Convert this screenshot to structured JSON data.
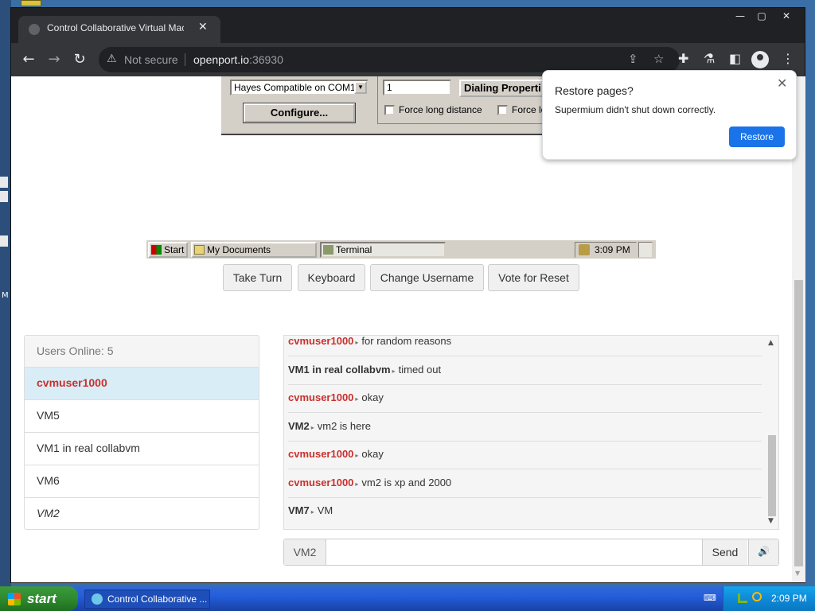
{
  "browser": {
    "tab_title": "Control Collaborative Virtual Machine",
    "url_security": "Not secure",
    "url_host": "openport.io",
    "url_port": ":36930"
  },
  "vm_screen": {
    "modem_select_value": "Hayes Compatible on COM1",
    "configure_label": "Configure...",
    "area_code_value": "1",
    "dialing_properties_label": "Dialing Properti",
    "force_long_distance_label": "Force long distance",
    "force_local_label": "Force lo",
    "taskbar": {
      "start_label": "Start",
      "my_documents_label": "My Documents",
      "terminal_label": "Terminal",
      "clock": "3:09 PM"
    }
  },
  "controls": {
    "take_turn": "Take Turn",
    "keyboard": "Keyboard",
    "change_username": "Change Username",
    "vote_reset": "Vote for Reset"
  },
  "users": {
    "heading": "Users Online: 5",
    "list": [
      "cvmuser1000",
      "VM5",
      "VM1 in real collabvm",
      "VM6",
      "VM2"
    ]
  },
  "chat": {
    "messages": [
      {
        "user": "cvmuser1000",
        "text": "for random reasons",
        "highlight": true
      },
      {
        "user": "VM1 in real collabvm",
        "text": "timed out",
        "highlight": false
      },
      {
        "user": "cvmuser1000",
        "text": "okay",
        "highlight": true
      },
      {
        "user": "VM2",
        "text": "vm2 is here",
        "highlight": false
      },
      {
        "user": "cvmuser1000",
        "text": "okay",
        "highlight": true
      },
      {
        "user": "cvmuser1000",
        "text": "vm2 is xp and 2000",
        "highlight": true
      },
      {
        "user": "VM7",
        "text": "VM",
        "highlight": false
      }
    ],
    "name_addon": "VM2",
    "send_label": "Send"
  },
  "restore_popup": {
    "title": "Restore pages?",
    "message": "Supermium didn't shut down correctly.",
    "button": "Restore"
  },
  "host_taskbar": {
    "start_label": "start",
    "task_label": "Control Collaborative ...",
    "clock": "2:09 PM"
  },
  "colors": {
    "accent_blue": "#1a73e8",
    "highlight_user": "#c9302c",
    "selected_row": "#d9edf7"
  }
}
